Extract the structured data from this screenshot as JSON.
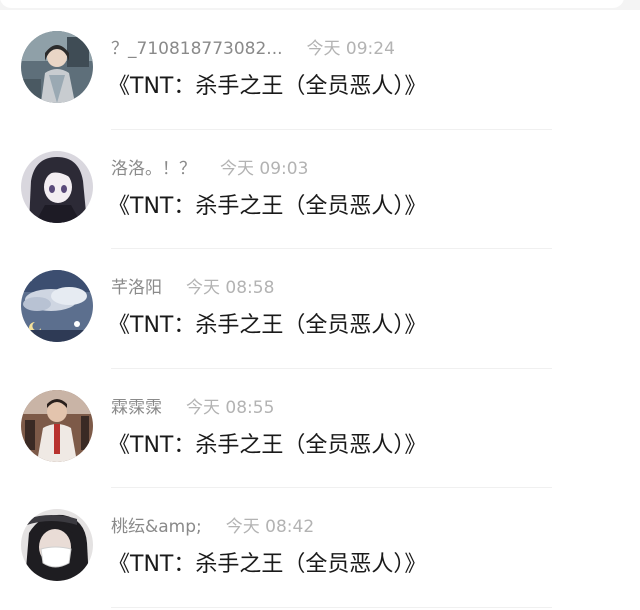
{
  "comments": [
    {
      "username": "？_710818773082...",
      "time": "今天 09:24",
      "message": "《TNT：杀手之王（全员恶人）》",
      "avatar_icon": "avatar-portrait-1"
    },
    {
      "username": "洛洛。！？",
      "time": "今天 09:03",
      "message": "《TNT：杀手之王（全员恶人）》",
      "avatar_icon": "avatar-anime-girl"
    },
    {
      "username": "芊洛阳",
      "time": "今天 08:58",
      "message": "《TNT：杀手之王（全员恶人）》",
      "avatar_icon": "avatar-night-sky"
    },
    {
      "username": "霖霂霂",
      "time": "今天 08:55",
      "message": "《TNT：杀手之王（全员恶人）》",
      "avatar_icon": "avatar-boy-photo"
    },
    {
      "username": "桃纭&amp;",
      "time": "今天 08:42",
      "message": "《TNT：杀手之王（全员恶人）》",
      "avatar_icon": "avatar-masked-person"
    }
  ],
  "colors": {
    "username": "#8a8a8a",
    "timestamp": "#b3b3b3",
    "message": "#1a1a1a",
    "divider": "#f0f0f0"
  }
}
